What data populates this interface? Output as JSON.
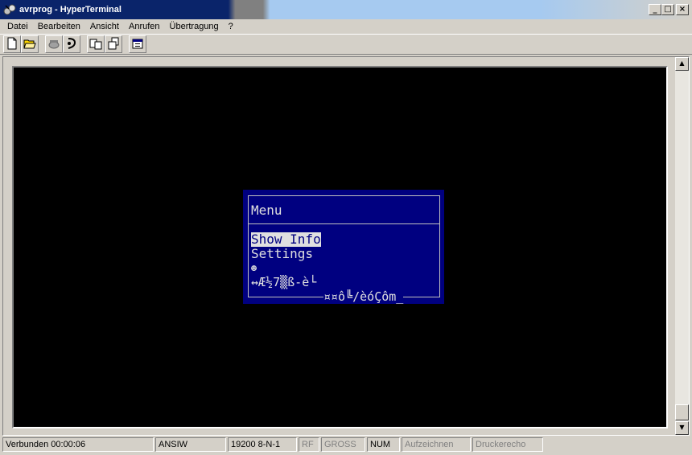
{
  "window": {
    "title": "avrprog - HyperTerminal",
    "controls": {
      "minimize": "_",
      "maximize": "□",
      "close": "×"
    }
  },
  "menubar": [
    "Datei",
    "Bearbeiten",
    "Ansicht",
    "Anrufen",
    "Übertragung",
    "?"
  ],
  "toolbar": {
    "buttons": [
      "new-connection-icon",
      "open-icon",
      "connect-phone-icon",
      "disconnect-icon",
      "send-icon",
      "receive-icon",
      "properties-icon"
    ]
  },
  "terminal": {
    "menu_title": "Menu",
    "items": [
      "Show Info",
      "Settings"
    ],
    "selected_item": "Show Info",
    "garbage_line_1": "☻",
    "garbage_line_2": "↔Æ½7▒ß-è└",
    "garbage_line_3": "¤¤ô╚/èóÇôm_"
  },
  "statusbar": {
    "connected": "Verbunden 00:00:06",
    "emulation": "ANSIW",
    "port_settings": "19200 8-N-1",
    "rf": "RF",
    "caps": "GROSS",
    "num": "NUM",
    "capture": "Aufzeichnen",
    "print_echo": "Druckerecho"
  },
  "colors": {
    "terminal_bg": "#000000",
    "menu_bg": "#000080",
    "menu_text": "#e0e0e0",
    "title_bar": "#0a246a"
  }
}
